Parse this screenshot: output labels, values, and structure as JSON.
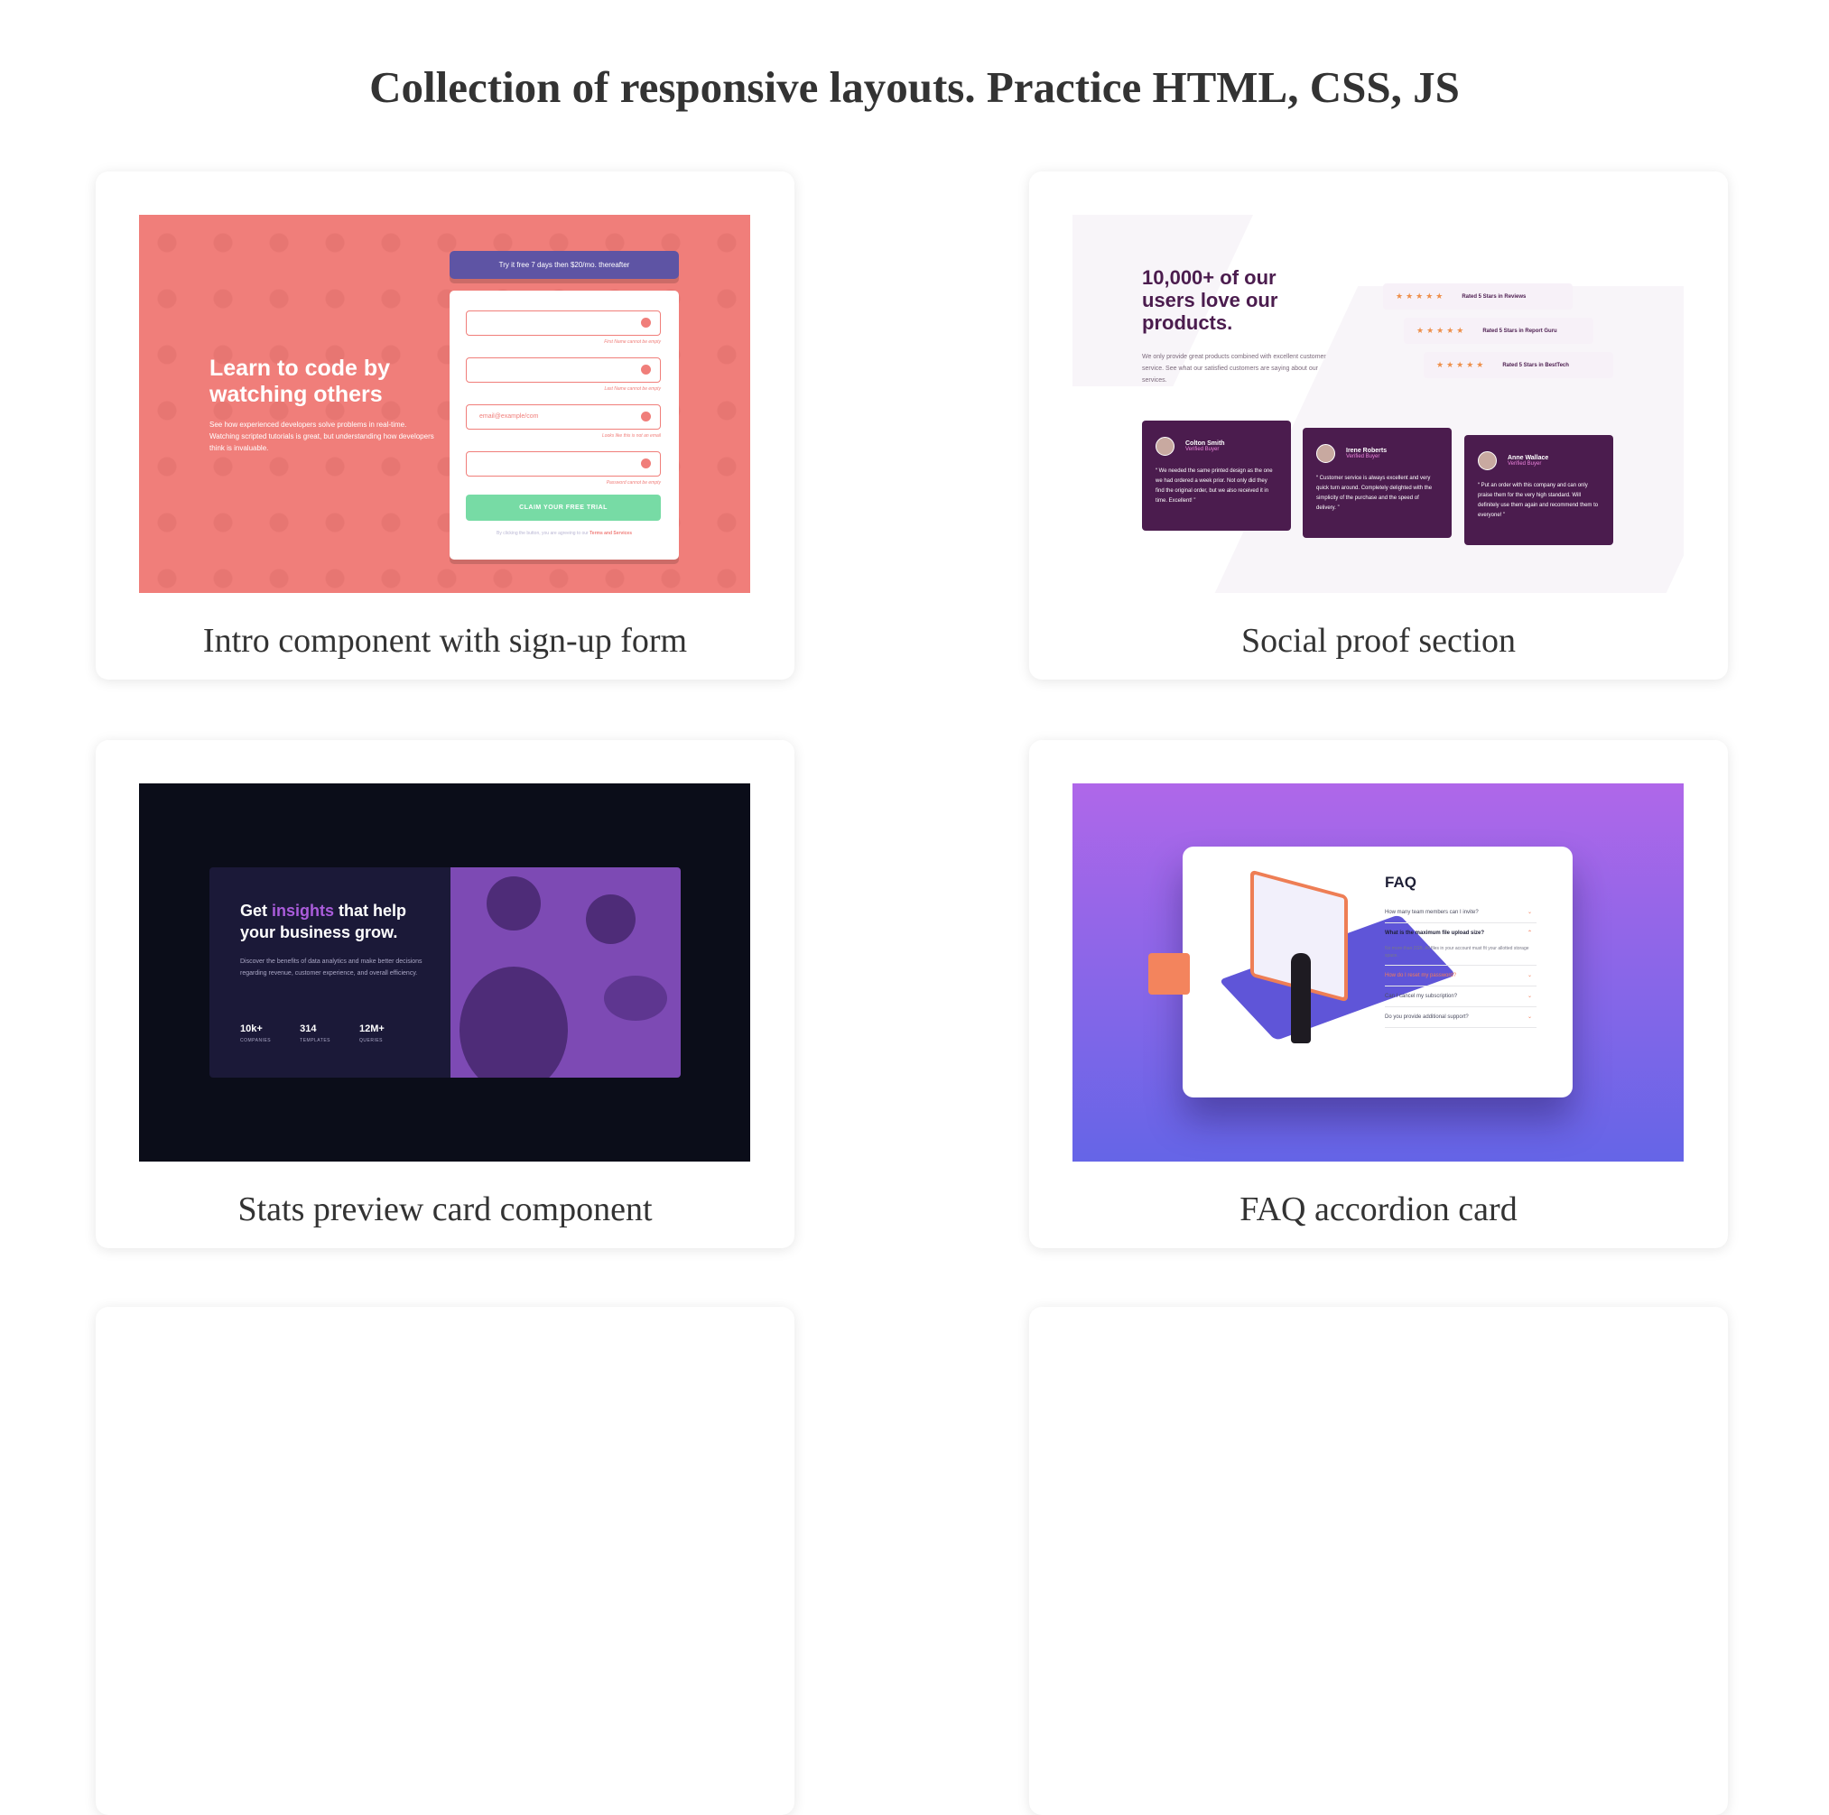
{
  "page": {
    "title": "Collection of responsive layouts. Practice HTML, CSS, JS"
  },
  "cards": [
    {
      "caption": "Intro component with sign-up form",
      "preview": {
        "heading": "Learn to code by watching others",
        "text": "See how experienced developers solve problems in real-time. Watching scripted tutorials is great, but understanding how developers think is invaluable.",
        "banner": "Try it free 7 days then $20/mo. thereafter",
        "email_value": "email@example/com",
        "errors": [
          "First Name cannot be empty",
          "Last Name cannot be empty",
          "Looks like this is not an email",
          "Password cannot be empty"
        ],
        "button": "CLAIM YOUR FREE TRIAL",
        "terms_prefix": "By clicking the button, you are agreeing to our",
        "terms_link": "Terms and Services",
        "colors": {
          "background": "#f07e7a",
          "banner": "#5e54a4",
          "button": "#77dba5"
        }
      }
    },
    {
      "caption": "Social proof section",
      "preview": {
        "heading": "10,000+ of our users love our products.",
        "text": "We only provide great products combined with excellent customer service. See what our satisfied customers are saying about our services.",
        "ratings": [
          "Rated 5 Stars in Reviews",
          "Rated 5 Stars in Report Guru",
          "Rated 5 Stars in BestTech"
        ],
        "stars": "★★★★★",
        "testimonials": [
          {
            "name": "Colton Smith",
            "badge": "Verified Buyer",
            "quote": "“ We needed the same printed design as the one we had ordered a week prior. Not only did they find the original order, but we also received it in time. Excellent! ”"
          },
          {
            "name": "Irene Roberts",
            "badge": "Verified Buyer",
            "quote": "“ Customer service is always excellent and very quick turn around. Completely delighted with the simplicity of the purchase and the speed of delivery. ”"
          },
          {
            "name": "Anne Wallace",
            "badge": "Verified Buyer",
            "quote": "“ Put an order with this company and can only praise them for the very high standard. Will definitely use them again and recommend them to everyone! ”"
          }
        ],
        "colors": {
          "primary": "#4b1c4e",
          "star": "#ee8f4a"
        }
      }
    },
    {
      "caption": "Stats preview card component",
      "preview": {
        "heading_start": "Get ",
        "heading_accent": "insights",
        "heading_end": " that help your business grow.",
        "text": "Discover the benefits of data analytics and make better decisions regarding revenue, customer experience, and overall efficiency.",
        "stats": [
          {
            "value": "10k+",
            "label": "COMPANIES"
          },
          {
            "value": "314",
            "label": "TEMPLATES"
          },
          {
            "value": "12M+",
            "label": "QUERIES"
          }
        ],
        "colors": {
          "background": "#0b0d19",
          "card": "#1b1938",
          "accent": "#aa5cdb"
        }
      }
    },
    {
      "caption": "FAQ accordion card",
      "preview": {
        "heading": "FAQ",
        "questions": [
          "How many team members can I invite?",
          "What is the maximum file upload size?",
          "How do I reset my password?",
          "Can I cancel my subscription?",
          "Do you provide additional support?"
        ],
        "answer": "No more than 2GB. All files in your account must fit your allotted storage space.",
        "chevron": "⌄",
        "colors": {
          "gradient_top": "#af67e9",
          "gradient_bottom": "#6565e7",
          "accent": "#f47b56"
        }
      }
    }
  ]
}
